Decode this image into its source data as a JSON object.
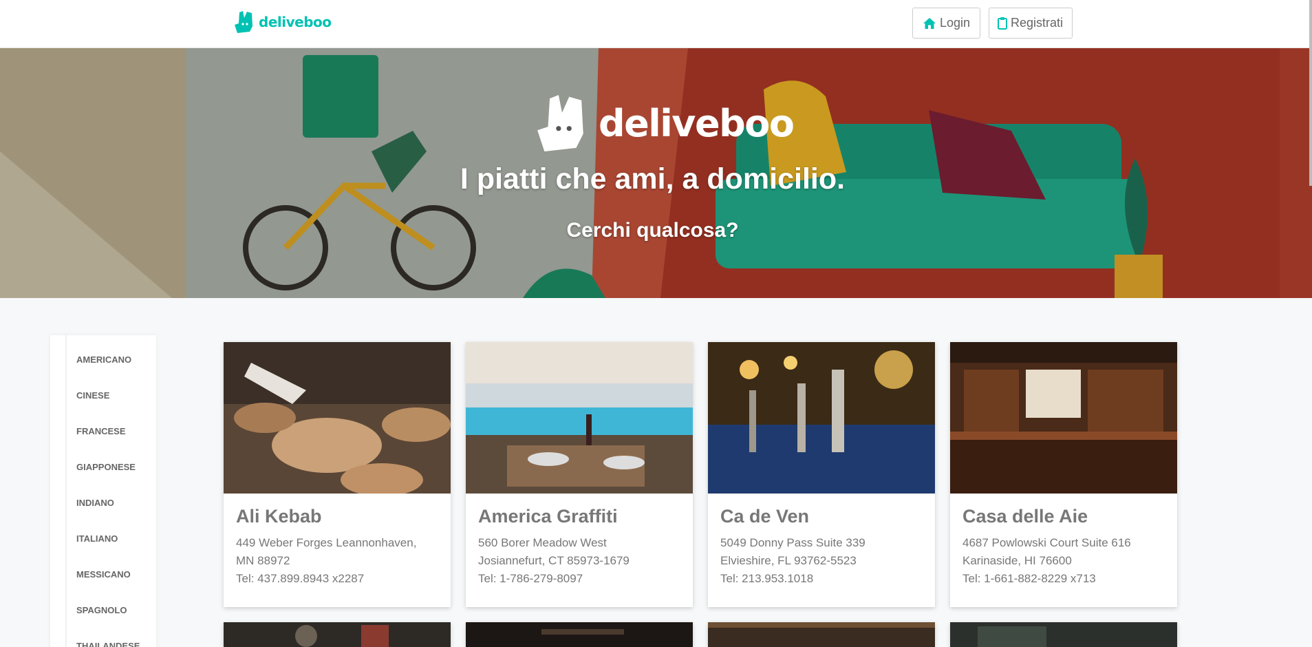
{
  "brand": {
    "name": "deliveboo",
    "color": "#00c2b3"
  },
  "header": {
    "login_label": "Login",
    "login_icon": "home-icon",
    "register_label": "Registrati",
    "register_icon": "clipboard-icon"
  },
  "hero": {
    "logo_text": "deliveboo",
    "title": "I piatti che ami, a domicilio.",
    "subtitle": "Cerchi qualcosa?"
  },
  "categories": [
    "AMERICANO",
    "CINESE",
    "FRANCESE",
    "GIAPPONESE",
    "INDIANO",
    "ITALIANO",
    "MESSICANO",
    "SPAGNOLO",
    "THAILANDESE"
  ],
  "restaurants": [
    {
      "name": "Ali Kebab",
      "address1": "449 Weber Forges Leannonhaven,",
      "address2": "MN 88972",
      "phone": "Tel: 437.899.8943 x2287"
    },
    {
      "name": "America Graffiti",
      "address1": "560 Borer Meadow West",
      "address2": "Josiannefurt, CT 85973-1679",
      "phone": "Tel: 1-786-279-8097"
    },
    {
      "name": "Ca de Ven",
      "address1": "5049 Donny Pass Suite 339",
      "address2": "Elvieshire, FL 93762-5523",
      "phone": "Tel: 213.953.1018"
    },
    {
      "name": "Casa delle Aie",
      "address1": "4687 Powlowski Court Suite 616",
      "address2": "Karinaside, HI 76600",
      "phone": "Tel: 1-661-882-8229 x713"
    }
  ]
}
